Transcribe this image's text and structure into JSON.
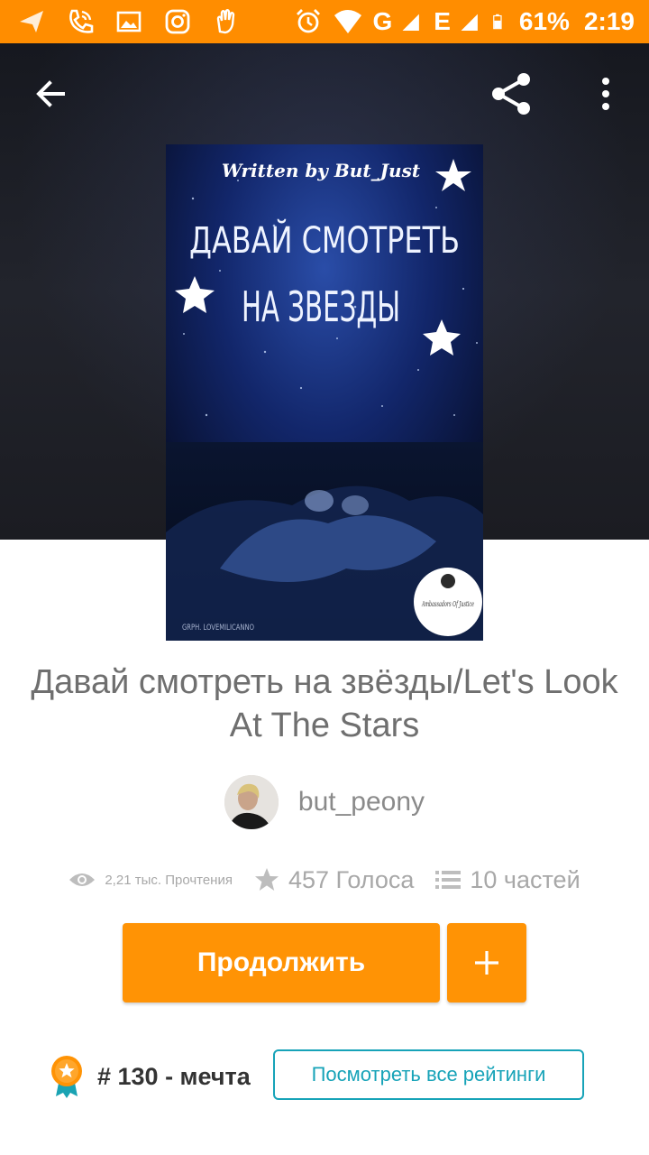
{
  "status_bar": {
    "battery": "61%",
    "time": "2:19",
    "network_label": "G",
    "network_label_2": "E",
    "icons": [
      "nav-arrow-icon",
      "phone-icon",
      "image-icon",
      "instagram-icon",
      "hand-icon",
      "alarm-icon",
      "wifi-icon",
      "signal-icon",
      "battery-icon"
    ]
  },
  "toolbar": {
    "back_icon": "arrow-left-icon",
    "share_icon": "share-icon",
    "more_icon": "more-vertical-icon"
  },
  "cover": {
    "byline": "Written by But_Just",
    "title_line1": "ДАВАЙ СМОТРЕТЬ",
    "title_line2": "НА ЗВЕЗДЫ",
    "credit": "GRPH. LOVEMILICANNO",
    "badge_text": "Ambassadors Of Justice"
  },
  "story": {
    "title": "Давай смотреть на звёзды/Let's Look At The Stars",
    "author": "but_peony"
  },
  "stats": {
    "reads": "2,21 тыс. Прочтения",
    "votes": "457 Голоса",
    "parts": "10 частей"
  },
  "actions": {
    "continue_label": "Продолжить",
    "add_label": "+"
  },
  "ranking": {
    "rank_text": "# 130 - мечта",
    "view_all_label": "Посмотреть все рейтинги"
  },
  "colors": {
    "status_bar": "#ff8d00",
    "primary_button": "#ff9305",
    "ranking_outline": "#17a3b8",
    "title_text": "#6f6f6f"
  }
}
